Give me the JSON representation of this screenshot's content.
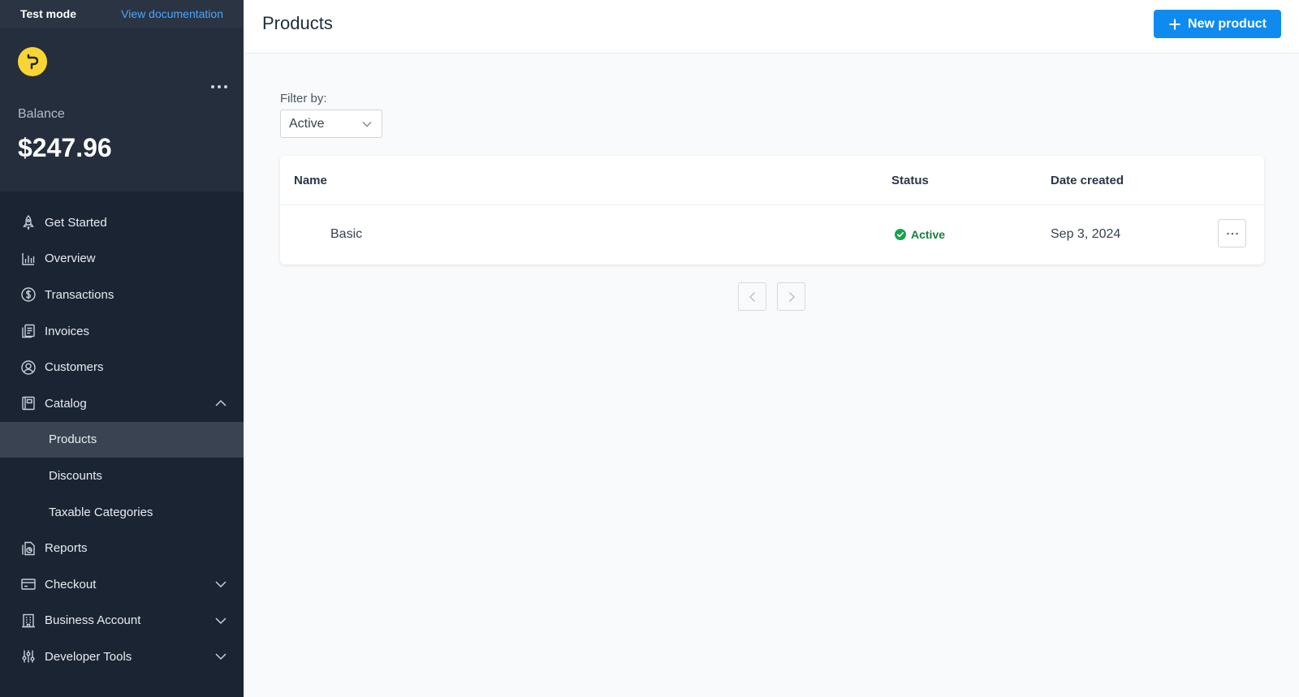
{
  "topbar": {
    "mode_label": "Test mode",
    "docs_link": "View documentation"
  },
  "account": {
    "logo_letter": "P",
    "balance_label": "Balance",
    "balance_value": "$247.96"
  },
  "sidebar": {
    "items": [
      {
        "label": "Get Started",
        "icon": "rocket-icon"
      },
      {
        "label": "Overview",
        "icon": "bar-chart-icon"
      },
      {
        "label": "Transactions",
        "icon": "dollar-circle-icon"
      },
      {
        "label": "Invoices",
        "icon": "invoice-icon"
      },
      {
        "label": "Customers",
        "icon": "user-circle-icon"
      },
      {
        "label": "Catalog",
        "icon": "catalog-icon",
        "expanded": true
      }
    ],
    "catalog_children": [
      {
        "label": "Products",
        "active": true
      },
      {
        "label": "Discounts"
      },
      {
        "label": "Taxable Categories"
      }
    ],
    "items_after": [
      {
        "label": "Reports",
        "icon": "reports-icon"
      },
      {
        "label": "Checkout",
        "icon": "credit-card-icon",
        "expandable": true
      },
      {
        "label": "Business Account",
        "icon": "building-icon",
        "expandable": true
      },
      {
        "label": "Developer Tools",
        "icon": "sliders-icon",
        "expandable": true
      }
    ]
  },
  "header": {
    "title": "Products",
    "new_button_label": "New product"
  },
  "filter": {
    "label": "Filter by:",
    "selected": "Active"
  },
  "table": {
    "columns": [
      "Name",
      "Status",
      "Date created"
    ],
    "rows": [
      {
        "name": "Basic",
        "status": "Active",
        "date_created": "Sep 3, 2024"
      }
    ]
  },
  "colors": {
    "sidebar_bg": "#1b2433",
    "accent": "#0f8bf0",
    "status_active": "#15803d",
    "logo_yellow": "#f9d534"
  }
}
